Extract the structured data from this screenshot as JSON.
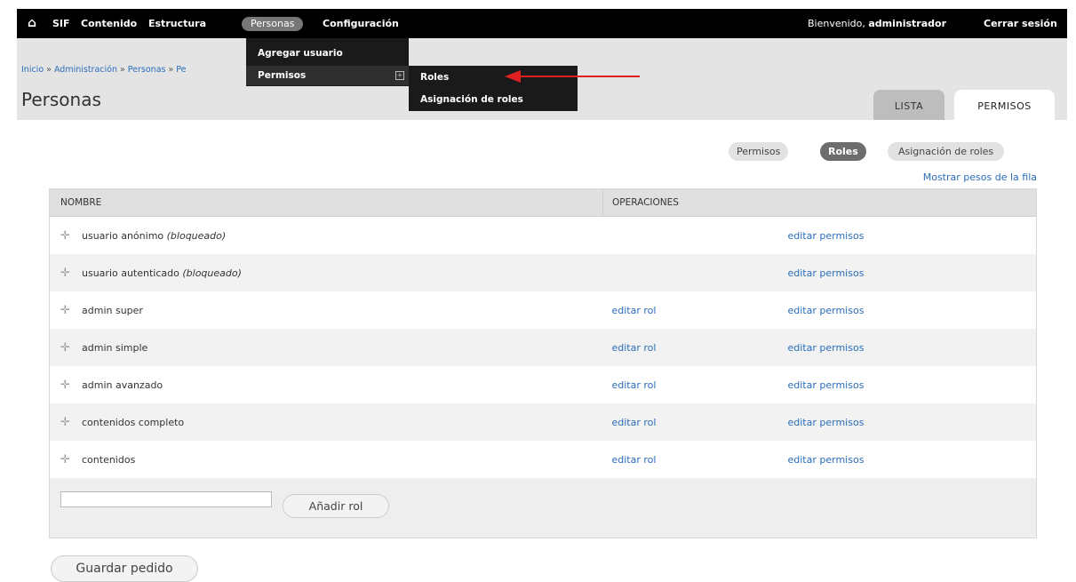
{
  "toolbar": {
    "home_icon": "home-icon",
    "items": [
      "SIF",
      "Contenido",
      "Estructura",
      "Personas",
      "Configuración"
    ],
    "welcome_prefix": "Bienvenido,",
    "welcome_user": "administrador",
    "logout": "Cerrar sesión"
  },
  "menu": {
    "personas_items": [
      "Agregar usuario",
      "Permisos"
    ],
    "permisos_items": [
      "Roles",
      "Asignación de roles"
    ]
  },
  "breadcrumb": [
    "Inicio",
    "Administración",
    "Personas",
    "Pe"
  ],
  "page_title": "Personas",
  "tabs": [
    "LISTA",
    "PERMISOS"
  ],
  "secondary_tabs": [
    "Permisos",
    "Roles",
    "Asignación de roles"
  ],
  "show_weights": "Mostrar pesos de la fila",
  "table": {
    "headers": [
      "NOMBRE",
      "OPERACIONES"
    ],
    "rows": [
      {
        "name": "usuario anónimo",
        "note": "(bloqueado)",
        "edit_role": "",
        "edit_perms": "editar permisos"
      },
      {
        "name": "usuario autenticado",
        "note": "(bloqueado)",
        "edit_role": "",
        "edit_perms": "editar permisos"
      },
      {
        "name": "admin super",
        "note": "",
        "edit_role": "editar rol",
        "edit_perms": "editar permisos"
      },
      {
        "name": "admin simple",
        "note": "",
        "edit_role": "editar rol",
        "edit_perms": "editar permisos"
      },
      {
        "name": "admin avanzado",
        "note": "",
        "edit_role": "editar rol",
        "edit_perms": "editar permisos"
      },
      {
        "name": "contenidos completo",
        "note": "",
        "edit_role": "editar rol",
        "edit_perms": "editar permisos"
      },
      {
        "name": "contenidos",
        "note": "",
        "edit_role": "editar rol",
        "edit_perms": "editar permisos"
      }
    ]
  },
  "add_role": {
    "input_value": "",
    "button": "Añadir rol"
  },
  "save_button": "Guardar pedido",
  "colors": {
    "toolbar_bg": "#000000",
    "link": "#2a6dbb",
    "active_pill": "#6d6d6d",
    "arrow": "#e02020"
  }
}
